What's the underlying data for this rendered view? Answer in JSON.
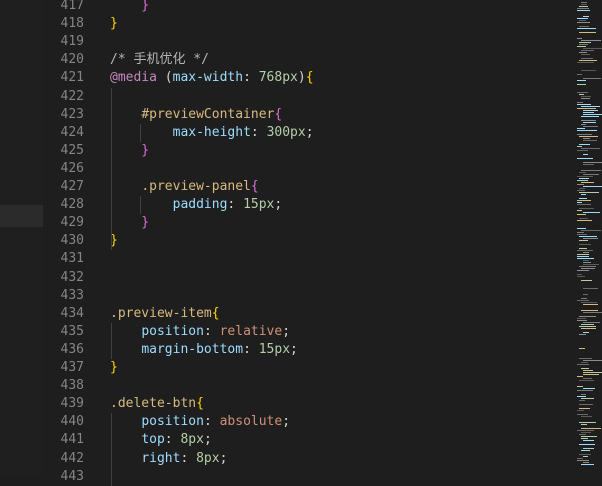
{
  "editor": {
    "lines": [
      {
        "n": "417",
        "tokens": [
          {
            "t": "    }",
            "c": "brace-p"
          }
        ]
      },
      {
        "n": "418",
        "tokens": [
          {
            "t": "}",
            "c": "brace-y"
          }
        ]
      },
      {
        "n": "419",
        "tokens": []
      },
      {
        "n": "420",
        "tokens": [
          {
            "t": "/* 手机优化 */",
            "c": "comment"
          }
        ]
      },
      {
        "n": "421",
        "tokens": [
          {
            "t": "@media",
            "c": "at"
          },
          {
            "t": " (",
            "c": "punc"
          },
          {
            "t": "max-width",
            "c": "prop"
          },
          {
            "t": ": ",
            "c": "punc"
          },
          {
            "t": "768px",
            "c": "val-num"
          },
          {
            "t": ")",
            "c": "punc"
          },
          {
            "t": "{",
            "c": "brace-y"
          }
        ]
      },
      {
        "n": "422",
        "tokens": []
      },
      {
        "n": "423",
        "tokens": [
          {
            "t": "    ",
            "c": "punc"
          },
          {
            "t": "#previewContainer",
            "c": "sel"
          },
          {
            "t": "{",
            "c": "brace-p"
          }
        ]
      },
      {
        "n": "424",
        "tokens": [
          {
            "t": "        ",
            "c": "punc"
          },
          {
            "t": "max-height",
            "c": "prop"
          },
          {
            "t": ": ",
            "c": "punc"
          },
          {
            "t": "300px",
            "c": "val-num"
          },
          {
            "t": ";",
            "c": "punc"
          }
        ]
      },
      {
        "n": "425",
        "tokens": [
          {
            "t": "    }",
            "c": "brace-p"
          }
        ]
      },
      {
        "n": "426",
        "tokens": []
      },
      {
        "n": "427",
        "tokens": [
          {
            "t": "    ",
            "c": "punc"
          },
          {
            "t": ".preview-panel",
            "c": "sel"
          },
          {
            "t": "{",
            "c": "brace-p"
          }
        ]
      },
      {
        "n": "428",
        "tokens": [
          {
            "t": "        ",
            "c": "punc"
          },
          {
            "t": "padding",
            "c": "prop"
          },
          {
            "t": ": ",
            "c": "punc"
          },
          {
            "t": "15px",
            "c": "val-num"
          },
          {
            "t": ";",
            "c": "punc"
          }
        ]
      },
      {
        "n": "429",
        "tokens": [
          {
            "t": "    }",
            "c": "brace-p"
          }
        ]
      },
      {
        "n": "430",
        "tokens": [
          {
            "t": "}",
            "c": "brace-y"
          }
        ]
      },
      {
        "n": "431",
        "tokens": []
      },
      {
        "n": "432",
        "tokens": []
      },
      {
        "n": "433",
        "tokens": []
      },
      {
        "n": "434",
        "tokens": [
          {
            "t": ".preview-item",
            "c": "sel"
          },
          {
            "t": "{",
            "c": "brace-y"
          }
        ]
      },
      {
        "n": "435",
        "tokens": [
          {
            "t": "    ",
            "c": "punc"
          },
          {
            "t": "position",
            "c": "prop"
          },
          {
            "t": ": ",
            "c": "punc"
          },
          {
            "t": "relative",
            "c": "val"
          },
          {
            "t": ";",
            "c": "punc"
          }
        ]
      },
      {
        "n": "436",
        "tokens": [
          {
            "t": "    ",
            "c": "punc"
          },
          {
            "t": "margin-bottom",
            "c": "prop"
          },
          {
            "t": ": ",
            "c": "punc"
          },
          {
            "t": "15px",
            "c": "val-num"
          },
          {
            "t": ";",
            "c": "punc"
          }
        ]
      },
      {
        "n": "437",
        "tokens": [
          {
            "t": "}",
            "c": "brace-y"
          }
        ]
      },
      {
        "n": "438",
        "tokens": []
      },
      {
        "n": "439",
        "tokens": [
          {
            "t": ".delete-btn",
            "c": "sel"
          },
          {
            "t": "{",
            "c": "brace-y"
          }
        ]
      },
      {
        "n": "440",
        "tokens": [
          {
            "t": "    ",
            "c": "punc"
          },
          {
            "t": "position",
            "c": "prop"
          },
          {
            "t": ": ",
            "c": "punc"
          },
          {
            "t": "absolute",
            "c": "val"
          },
          {
            "t": ";",
            "c": "punc"
          }
        ]
      },
      {
        "n": "441",
        "tokens": [
          {
            "t": "    ",
            "c": "punc"
          },
          {
            "t": "top",
            "c": "prop"
          },
          {
            "t": ": ",
            "c": "punc"
          },
          {
            "t": "8px",
            "c": "val-num"
          },
          {
            "t": ";",
            "c": "punc"
          }
        ]
      },
      {
        "n": "442",
        "tokens": [
          {
            "t": "    ",
            "c": "punc"
          },
          {
            "t": "right",
            "c": "prop"
          },
          {
            "t": ": ",
            "c": "punc"
          },
          {
            "t": "8px",
            "c": "val-num"
          },
          {
            "t": ";",
            "c": "punc"
          }
        ]
      },
      {
        "n": "443",
        "tokens": []
      }
    ]
  },
  "colors": {
    "background": "#1e1e1e",
    "line_number": "#858585",
    "selector": "#d7ba7d",
    "property": "#9cdcfe",
    "number": "#b5cea8",
    "keyword_value": "#ce9178",
    "at_rule": "#c586c0",
    "brace_outer": "#ffd700",
    "brace_inner": "#da70d6"
  }
}
